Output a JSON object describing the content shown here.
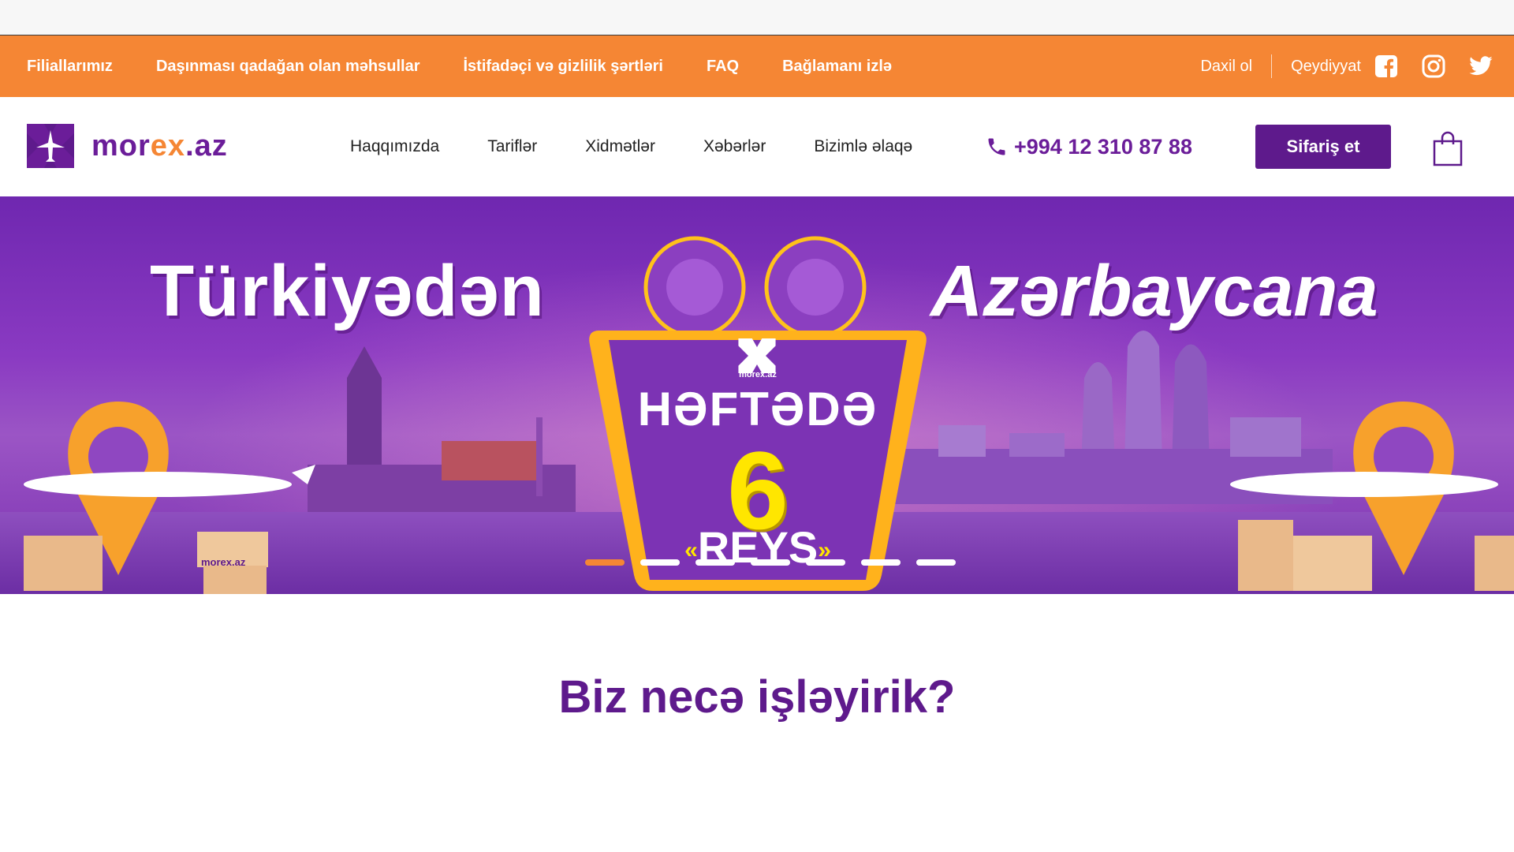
{
  "topbar": {
    "links": [
      "Filiallarımız",
      "Daşınması qadağan olan məhsullar",
      "İstifadəçi və gizlilik şərtləri",
      "FAQ",
      "Bağlamanı izlə"
    ],
    "login": "Daxil ol",
    "register": "Qeydiyyat",
    "social_icons": [
      "facebook-icon",
      "instagram-icon",
      "twitter-icon"
    ]
  },
  "nav": {
    "logo_text_a": "mor",
    "logo_text_b": "ex",
    "logo_text_c": ".az",
    "menu": [
      "Haqqımızda",
      "Tariflər",
      "Xidmətlər",
      "Xəbərlər",
      "Bizimlə əlaqə"
    ],
    "phone": "+994 12 310 87 88",
    "order_button": "Sifariş et",
    "cart_icon": "shopping-bag-icon"
  },
  "banner": {
    "title_left": "Türkiyədən",
    "title_right": "Azərbaycana",
    "sign_logo": "morex.az",
    "sign_title": "HƏFTƏDƏ",
    "sign_number": "6",
    "sign_sub": "REYS",
    "slides": 7,
    "active_slide": 1
  },
  "how_section": {
    "title": "Biz necə işləyirik?"
  },
  "colors": {
    "orange": "#f58634",
    "purple": "#5e1a8c",
    "banner": "#7a2fb0"
  }
}
